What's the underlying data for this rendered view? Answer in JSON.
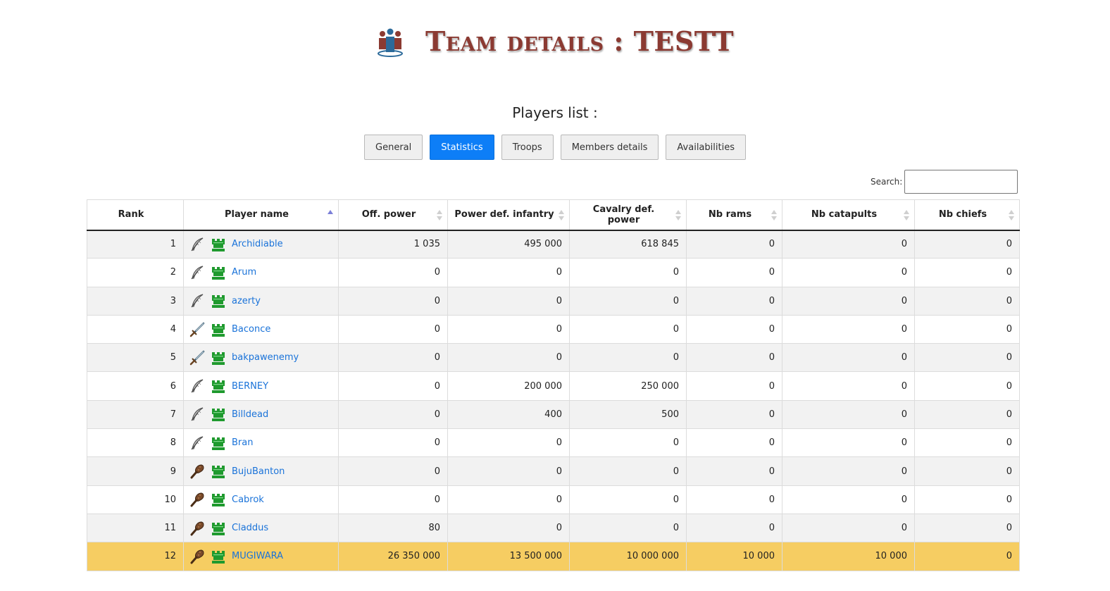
{
  "header": {
    "title": "Team details : TESTT",
    "icon": "team-group-icon"
  },
  "subtitle": "Players list :",
  "tabs": [
    {
      "label": "General",
      "active": false
    },
    {
      "label": "Statistics",
      "active": true
    },
    {
      "label": "Troops",
      "active": false
    },
    {
      "label": "Members details",
      "active": false
    },
    {
      "label": "Availabilities",
      "active": false
    }
  ],
  "search": {
    "label": "Search:",
    "value": ""
  },
  "table": {
    "columns": [
      "Rank",
      "Player name",
      "Off. power",
      "Power def. infantry",
      "Cavalry def. power",
      "Nb rams",
      "Nb catapults",
      "Nb chiefs"
    ],
    "sorted_column": "Player name",
    "rows": [
      {
        "rank": "1",
        "role_icon": "quill-icon",
        "status_icon": "green-castle-icon",
        "name": "Archidiable",
        "off": "1 035",
        "def_inf": "495 000",
        "def_cav": "618 845",
        "rams": "0",
        "catapults": "0",
        "chiefs": "0"
      },
      {
        "rank": "2",
        "role_icon": "quill-icon",
        "status_icon": "green-castle-icon",
        "name": "Arum",
        "off": "0",
        "def_inf": "0",
        "def_cav": "0",
        "rams": "0",
        "catapults": "0",
        "chiefs": "0"
      },
      {
        "rank": "3",
        "role_icon": "quill-icon",
        "status_icon": "green-castle-icon",
        "name": "azerty",
        "off": "0",
        "def_inf": "0",
        "def_cav": "0",
        "rams": "0",
        "catapults": "0",
        "chiefs": "0"
      },
      {
        "rank": "4",
        "role_icon": "sword-icon",
        "status_icon": "green-castle-icon",
        "name": "Baconce",
        "off": "0",
        "def_inf": "0",
        "def_cav": "0",
        "rams": "0",
        "catapults": "0",
        "chiefs": "0"
      },
      {
        "rank": "5",
        "role_icon": "sword-icon",
        "status_icon": "green-castle-icon",
        "name": "bakpawenemy",
        "off": "0",
        "def_inf": "0",
        "def_cav": "0",
        "rams": "0",
        "catapults": "0",
        "chiefs": "0"
      },
      {
        "rank": "6",
        "role_icon": "quill-icon",
        "status_icon": "green-castle-icon",
        "name": "BERNEY",
        "off": "0",
        "def_inf": "200 000",
        "def_cav": "250 000",
        "rams": "0",
        "catapults": "0",
        "chiefs": "0"
      },
      {
        "rank": "7",
        "role_icon": "quill-icon",
        "status_icon": "green-castle-icon",
        "name": "Billdead",
        "off": "0",
        "def_inf": "400",
        "def_cav": "500",
        "rams": "0",
        "catapults": "0",
        "chiefs": "0"
      },
      {
        "rank": "8",
        "role_icon": "quill-icon",
        "status_icon": "green-castle-icon",
        "name": "Bran",
        "off": "0",
        "def_inf": "0",
        "def_cav": "0",
        "rams": "0",
        "catapults": "0",
        "chiefs": "0"
      },
      {
        "rank": "9",
        "role_icon": "club-icon",
        "status_icon": "green-castle-icon",
        "name": "BujuBanton",
        "off": "0",
        "def_inf": "0",
        "def_cav": "0",
        "rams": "0",
        "catapults": "0",
        "chiefs": "0"
      },
      {
        "rank": "10",
        "role_icon": "club-icon",
        "status_icon": "green-castle-icon",
        "name": "Cabrok",
        "off": "0",
        "def_inf": "0",
        "def_cav": "0",
        "rams": "0",
        "catapults": "0",
        "chiefs": "0"
      },
      {
        "rank": "11",
        "role_icon": "club-icon",
        "status_icon": "green-castle-icon",
        "name": "Claddus",
        "off": "80",
        "def_inf": "0",
        "def_cav": "0",
        "rams": "0",
        "catapults": "0",
        "chiefs": "0"
      },
      {
        "rank": "12",
        "role_icon": "club-icon",
        "status_icon": "green-castle-icon",
        "name": "MUGIWARA",
        "off": "26 350 000",
        "def_inf": "13 500 000",
        "def_cav": "10 000 000",
        "rams": "10 000",
        "catapults": "10 000",
        "chiefs": "0",
        "highlighted": true
      }
    ]
  },
  "colors": {
    "title": "#8b3a32",
    "accent": "#0d7ef7",
    "link": "#1a73d9",
    "highlight_row": "#f6cd62",
    "castle": "#1f9a2e"
  }
}
